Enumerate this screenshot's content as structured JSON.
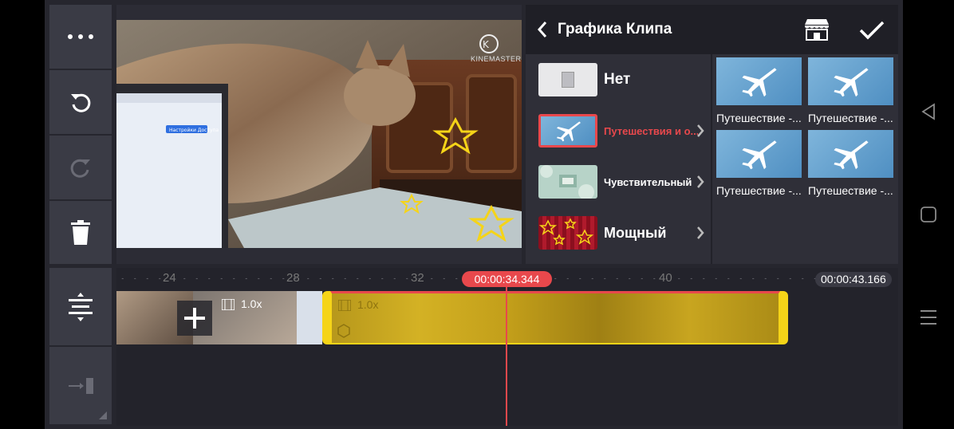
{
  "toolbar": {
    "more_icon": "more-horizontal",
    "undo_icon": "undo",
    "redo_icon": "redo",
    "delete_icon": "trash",
    "layers_icon": "expand-timeline",
    "jump_icon": "jump-to-end"
  },
  "preview": {
    "watermark": "KINEMASTER",
    "screen_button": "Настройки Доступа"
  },
  "panel": {
    "title": "Графика Клипа",
    "back_icon": "chevron-left",
    "store_icon": "store",
    "confirm_icon": "checkmark",
    "categories": [
      {
        "label": "Нет",
        "selected": false
      },
      {
        "label": "Путешествия и о...",
        "selected": true
      },
      {
        "label": "Чувствительный",
        "selected": false
      },
      {
        "label": "Мощный",
        "selected": false
      }
    ],
    "items": [
      {
        "label": "Путешествие -..."
      },
      {
        "label": "Путешествие -..."
      },
      {
        "label": "Путешествие -..."
      },
      {
        "label": "Путешествие -..."
      }
    ]
  },
  "timeline": {
    "ruler_marks": [
      "24",
      "28",
      "32",
      "40"
    ],
    "playhead_time": "00:00:34.344",
    "total_time": "00:00:43.166",
    "clip1_speed": "1.0x",
    "clip2_speed": "1.0x",
    "add_icon": "plus"
  },
  "colors": {
    "accent_red": "#e8484c",
    "selection_yellow": "#f5d418",
    "panel_bg": "#2f2f38",
    "toolbar_bg": "#3a3b45"
  },
  "navbar": {
    "back_icon": "triangle-back",
    "home_icon": "square-home",
    "menu_icon": "menu-lines"
  }
}
